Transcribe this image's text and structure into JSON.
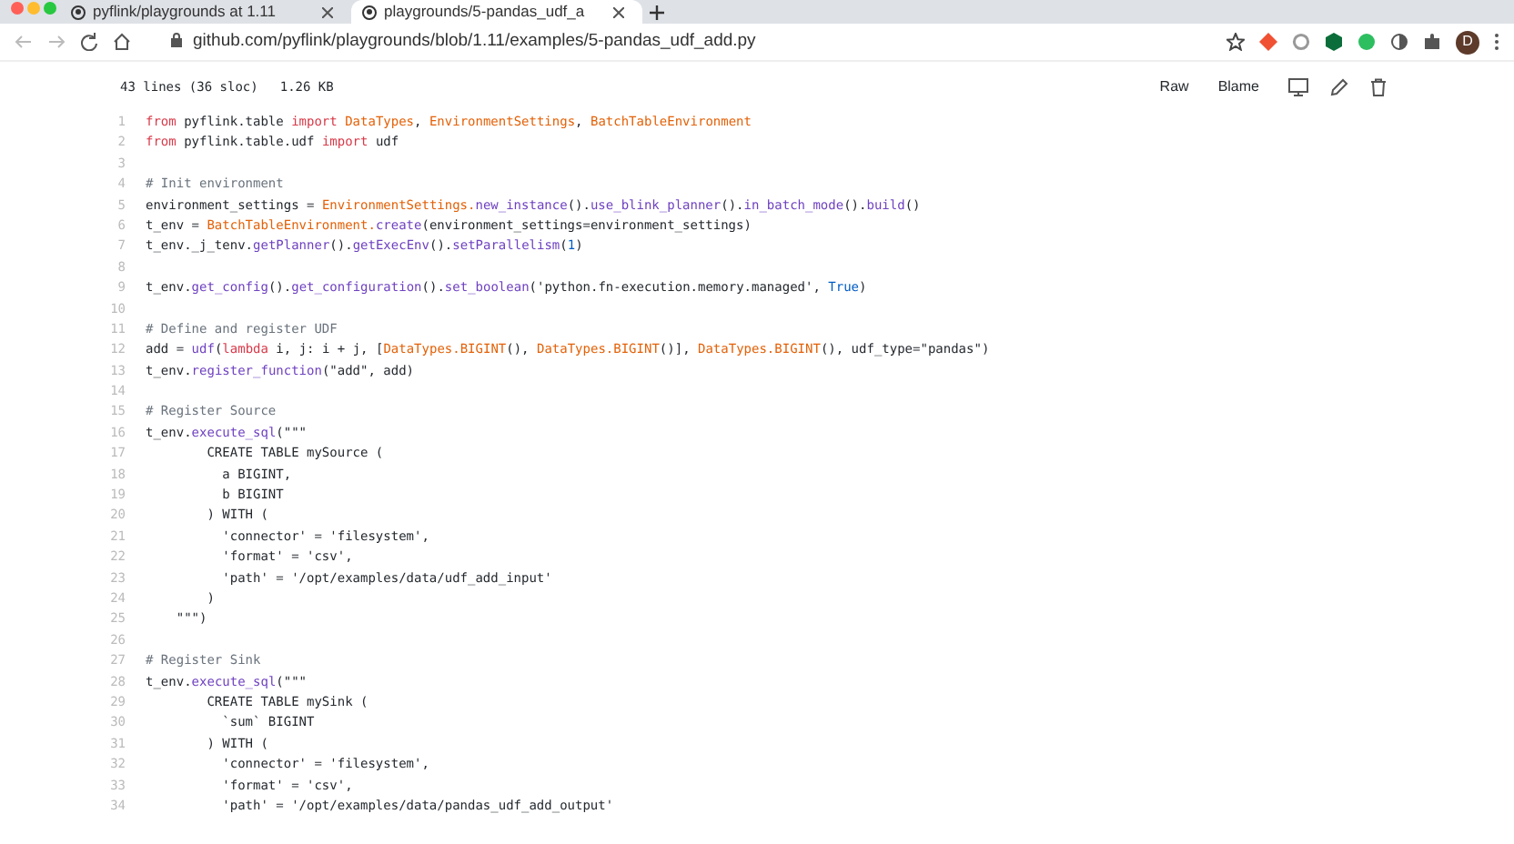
{
  "tabs": [
    {
      "title": "pyflink/playgrounds at 1.11",
      "selected": false
    },
    {
      "title": "playgrounds/5-pandas_udf_a",
      "selected": true
    }
  ],
  "address_bar": {
    "url": "github.com/pyflink/playgrounds/blob/1.11/examples/5-pandas_udf_add.py"
  },
  "profile": {
    "initial": "D"
  },
  "file_header": {
    "info": "43 lines (36 sloc)",
    "size": "1.26 KB",
    "buttons": [
      "Raw",
      "Blame"
    ]
  },
  "code_lines": [
    {
      "number": "1",
      "tokens": [
        {
          "kind": "kw",
          "text": "from"
        },
        {
          "kind": "plain",
          "text": " pyflink.table "
        },
        {
          "kind": "kw",
          "text": "import "
        },
        {
          "kind": "cls",
          "text": "DataTypes"
        },
        {
          "kind": "plain",
          "text": ", "
        },
        {
          "kind": "cls",
          "text": "EnvironmentSettings"
        },
        {
          "kind": "plain",
          "text": ", "
        },
        {
          "kind": "cls",
          "text": "BatchTableEnvironment"
        }
      ]
    },
    {
      "number": "2",
      "tokens": [
        {
          "kind": "kw",
          "text": "from"
        },
        {
          "kind": "plain",
          "text": " pyflink.table.udf "
        },
        {
          "kind": "kw",
          "text": "import"
        },
        {
          "kind": "plain",
          "text": " udf"
        }
      ]
    },
    {
      "number": "3"
    },
    {
      "number": "4",
      "tokens": [
        {
          "kind": "comment",
          "text": "# Init environment"
        }
      ]
    },
    {
      "number": "5",
      "tokens": [
        {
          "kind": "plain",
          "text": "environment_settings = "
        },
        {
          "kind": "cls",
          "text": "EnvironmentSettings."
        },
        {
          "kind": "func",
          "text": "new_instance"
        },
        {
          "kind": "plain",
          "text": "()."
        },
        {
          "kind": "func",
          "text": "use_blink_planner"
        },
        {
          "kind": "plain",
          "text": "()."
        },
        {
          "kind": "func",
          "text": "in_batch_mode"
        },
        {
          "kind": "plain",
          "text": "()."
        },
        {
          "kind": "func",
          "text": "build"
        },
        {
          "kind": "plain",
          "text": "()"
        }
      ]
    },
    {
      "number": "6",
      "tokens": [
        {
          "kind": "plain",
          "text": "t_env = "
        },
        {
          "kind": "cls",
          "text": "BatchTableEnvironment."
        },
        {
          "kind": "func",
          "text": "create"
        },
        {
          "kind": "plain",
          "text": "(environment_settings=environment_settings)"
        }
      ]
    },
    {
      "number": "7",
      "tokens": [
        {
          "kind": "plain",
          "text": "t_env._j_tenv."
        },
        {
          "kind": "func",
          "text": "getPlanner"
        },
        {
          "kind": "plain",
          "text": "()."
        },
        {
          "kind": "func",
          "text": "getExecEnv"
        },
        {
          "kind": "plain",
          "text": "()."
        },
        {
          "kind": "func",
          "text": "setParallelism"
        },
        {
          "kind": "plain",
          "text": "("
        },
        {
          "kind": "const",
          "text": "1"
        },
        {
          "kind": "plain",
          "text": ")"
        }
      ]
    },
    {
      "number": "8"
    },
    {
      "number": "9",
      "tokens": [
        {
          "kind": "plain",
          "text": "t_env."
        },
        {
          "kind": "func",
          "text": "get_config"
        },
        {
          "kind": "plain",
          "text": "()."
        },
        {
          "kind": "func",
          "text": "get_configuration"
        },
        {
          "kind": "plain",
          "text": "()."
        },
        {
          "kind": "func",
          "text": "set_boolean"
        },
        {
          "kind": "plain",
          "text": "('python.fn-execution.memory.managed', "
        },
        {
          "kind": "const",
          "text": "True"
        },
        {
          "kind": "plain",
          "text": ")"
        }
      ]
    },
    {
      "number": "10"
    },
    {
      "number": "11",
      "tokens": [
        {
          "kind": "comment",
          "text": "# Define and register UDF"
        }
      ]
    },
    {
      "number": "12",
      "tokens": [
        {
          "kind": "plain",
          "text": "add = "
        },
        {
          "kind": "func",
          "text": "udf"
        },
        {
          "kind": "plain",
          "text": "("
        },
        {
          "kind": "kw",
          "text": "lambda"
        },
        {
          "kind": "plain",
          "text": " i, j: i + j, ["
        },
        {
          "kind": "cls",
          "text": "DataTypes.BIGINT"
        },
        {
          "kind": "plain",
          "text": "(), "
        },
        {
          "kind": "cls",
          "text": "DataTypes.BIGINT"
        },
        {
          "kind": "plain",
          "text": "()], "
        },
        {
          "kind": "cls",
          "text": "DataTypes.BIGINT"
        },
        {
          "kind": "plain",
          "text": "(), udf_type=\"pandas\")"
        }
      ]
    },
    {
      "number": "13",
      "tokens": [
        {
          "kind": "plain",
          "text": "t_env."
        },
        {
          "kind": "func",
          "text": "register_function"
        },
        {
          "kind": "plain",
          "text": "(\"add\", add)"
        }
      ]
    },
    {
      "number": "14"
    },
    {
      "number": "15",
      "tokens": [
        {
          "kind": "comment",
          "text": "# Register Source"
        }
      ]
    },
    {
      "number": "16",
      "tokens": [
        {
          "kind": "plain",
          "text": "t_env."
        },
        {
          "kind": "func",
          "text": "execute_sql"
        },
        {
          "kind": "plain",
          "text": "(\"\"\""
        }
      ]
    },
    {
      "number": "17",
      "tokens": [
        {
          "kind": "plain",
          "text": "        CREATE TABLE mySource ("
        }
      ]
    },
    {
      "number": "18",
      "tokens": [
        {
          "kind": "plain",
          "text": "          a BIGINT,"
        }
      ]
    },
    {
      "number": "19",
      "tokens": [
        {
          "kind": "plain",
          "text": "          b BIGINT"
        }
      ]
    },
    {
      "number": "20",
      "tokens": [
        {
          "kind": "plain",
          "text": "        ) WITH ("
        }
      ]
    },
    {
      "number": "21",
      "tokens": [
        {
          "kind": "plain",
          "text": "          'connector' = 'filesystem',"
        }
      ]
    },
    {
      "number": "22",
      "tokens": [
        {
          "kind": "plain",
          "text": "          'format' = 'csv',"
        }
      ]
    },
    {
      "number": "23",
      "tokens": [
        {
          "kind": "plain",
          "text": "          'path' = '/opt/examples/data/udf_add_input'"
        }
      ]
    },
    {
      "number": "24",
      "tokens": [
        {
          "kind": "plain",
          "text": "        )"
        }
      ]
    },
    {
      "number": "25",
      "tokens": [
        {
          "kind": "plain",
          "text": "    \"\"\")"
        }
      ]
    },
    {
      "number": "26"
    },
    {
      "number": "27",
      "tokens": [
        {
          "kind": "comment",
          "text": "# Register Sink"
        }
      ]
    },
    {
      "number": "28",
      "tokens": [
        {
          "kind": "plain",
          "text": "t_env."
        },
        {
          "kind": "func",
          "text": "execute_sql"
        },
        {
          "kind": "plain",
          "text": "(\"\"\""
        }
      ]
    },
    {
      "number": "29",
      "tokens": [
        {
          "kind": "plain",
          "text": "        CREATE TABLE mySink ("
        }
      ]
    },
    {
      "number": "30",
      "tokens": [
        {
          "kind": "plain",
          "text": "          `sum` BIGINT"
        }
      ]
    },
    {
      "number": "31",
      "tokens": [
        {
          "kind": "plain",
          "text": "        ) WITH ("
        }
      ]
    },
    {
      "number": "32",
      "tokens": [
        {
          "kind": "plain",
          "text": "          'connector' = 'filesystem',"
        }
      ]
    },
    {
      "number": "33",
      "tokens": [
        {
          "kind": "plain",
          "text": "          'format' = 'csv',"
        }
      ]
    },
    {
      "number": "34",
      "tokens": [
        {
          "kind": "plain",
          "text": "          'path' = '/opt/examples/data/pandas_udf_add_output'"
        }
      ]
    }
  ]
}
